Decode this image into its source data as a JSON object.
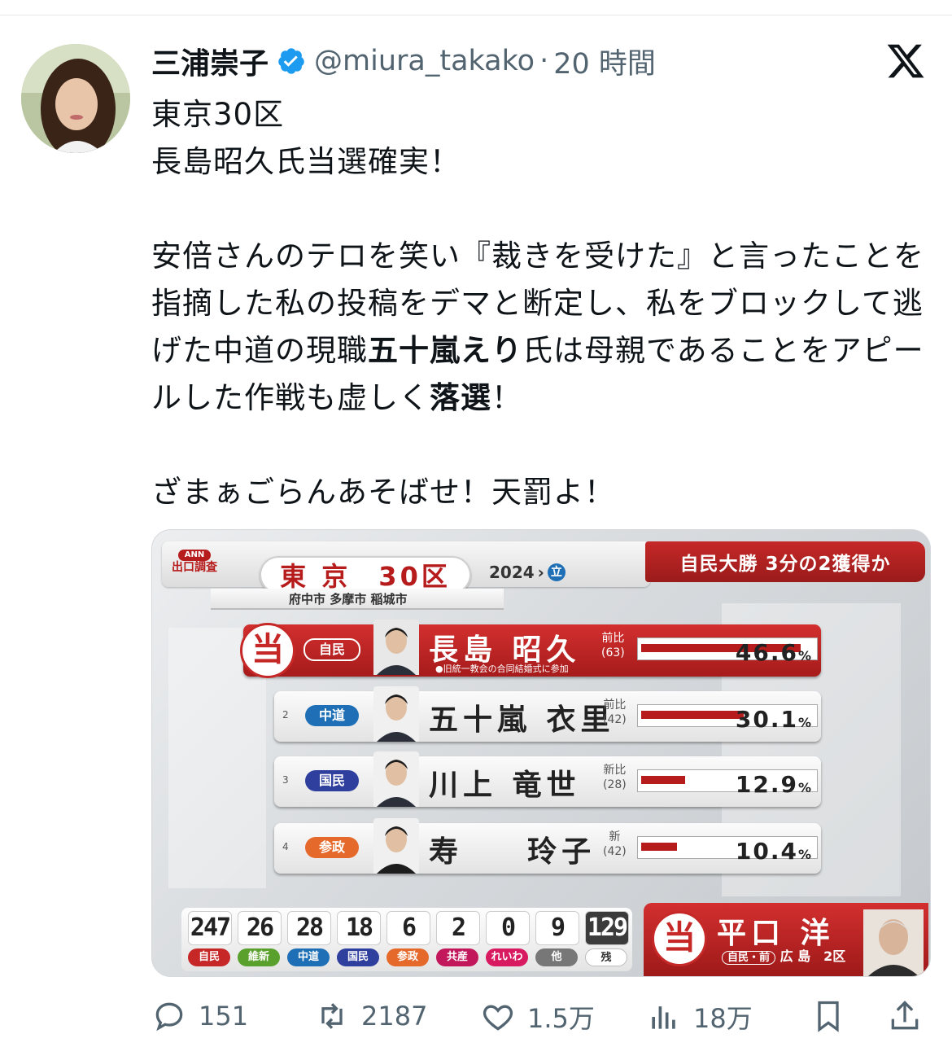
{
  "user": {
    "display_name": "三浦崇子",
    "handle": "@miura_takako",
    "separator": "·",
    "time": "20 時間"
  },
  "tweet": {
    "line1": "東京30区",
    "line2": "長島昭久氏当選確実！",
    "p2_a": "安倍さんのテロを笑い『裁きを受けた』と言ったことを指摘した私の投稿をデマと断定し、私をブロックして逃げた中道の現職",
    "p2_bold1": "五十嵐えり",
    "p2_b": "氏は母親であることをアピールした作戦も虚しく",
    "p2_bold2": "落選",
    "p2_c": "！",
    "line_last": "ざまぁごらんあそばせ！天罰よ！"
  },
  "card": {
    "ann_logo": "ANN",
    "ann_label": "出口調査",
    "pref": "東 京",
    "district": "30区",
    "year": "2024",
    "year_badge": "立",
    "headline": "自民大勝 3分の2獲得か",
    "cities": "府中市 多摩市 稲城市",
    "winner_mark": "当",
    "candidates": [
      {
        "rank": "",
        "party": "自民",
        "party_color": "#c62828",
        "name": "長島 昭久",
        "status": "前比",
        "age": "(63)",
        "pct": "46.6",
        "unit": "%",
        "share": 0.466,
        "note": "●旧統一教会の合同結婚式に参加"
      },
      {
        "rank": "2",
        "party": "中道",
        "party_color": "#1e6fb5",
        "name": "五十嵐 衣里",
        "status": "前比",
        "age": "(42)",
        "pct": "30.1",
        "unit": "%",
        "share": 0.301
      },
      {
        "rank": "3",
        "party": "国民",
        "party_color": "#2f3f9e",
        "name": "川上 竜世",
        "status": "新比",
        "age": "(28)",
        "pct": "12.9",
        "unit": "%",
        "share": 0.129
      },
      {
        "rank": "4",
        "party": "参政",
        "party_color": "#e5692a",
        "name": "寿 　 玲子",
        "status": "新",
        "age": "(42)",
        "pct": "10.4",
        "unit": "%",
        "share": 0.104
      }
    ],
    "tally": [
      {
        "num": "247",
        "label": "自民",
        "color": "#c62828"
      },
      {
        "num": "26",
        "label": "維新",
        "color": "#5aa02c"
      },
      {
        "num": "28",
        "label": "中道",
        "color": "#1e6fb5"
      },
      {
        "num": "18",
        "label": "国民",
        "color": "#2f3f9e"
      },
      {
        "num": "6",
        "label": "参政",
        "color": "#e5692a"
      },
      {
        "num": "2",
        "label": "共産",
        "color": "#c2185b"
      },
      {
        "num": "0",
        "label": "れいわ",
        "color": "#d81b60"
      },
      {
        "num": "9",
        "label": "他",
        "color": "#777777"
      },
      {
        "num": "129",
        "label": "残",
        "color": "#ffffff"
      }
    ],
    "win_box": {
      "name": "平口 洋",
      "sub_party": "自民・前",
      "sub_area": "広 島　2区"
    }
  },
  "actions": {
    "replies": "151",
    "retweets": "2187",
    "likes": "1.5万",
    "views": "18万"
  }
}
